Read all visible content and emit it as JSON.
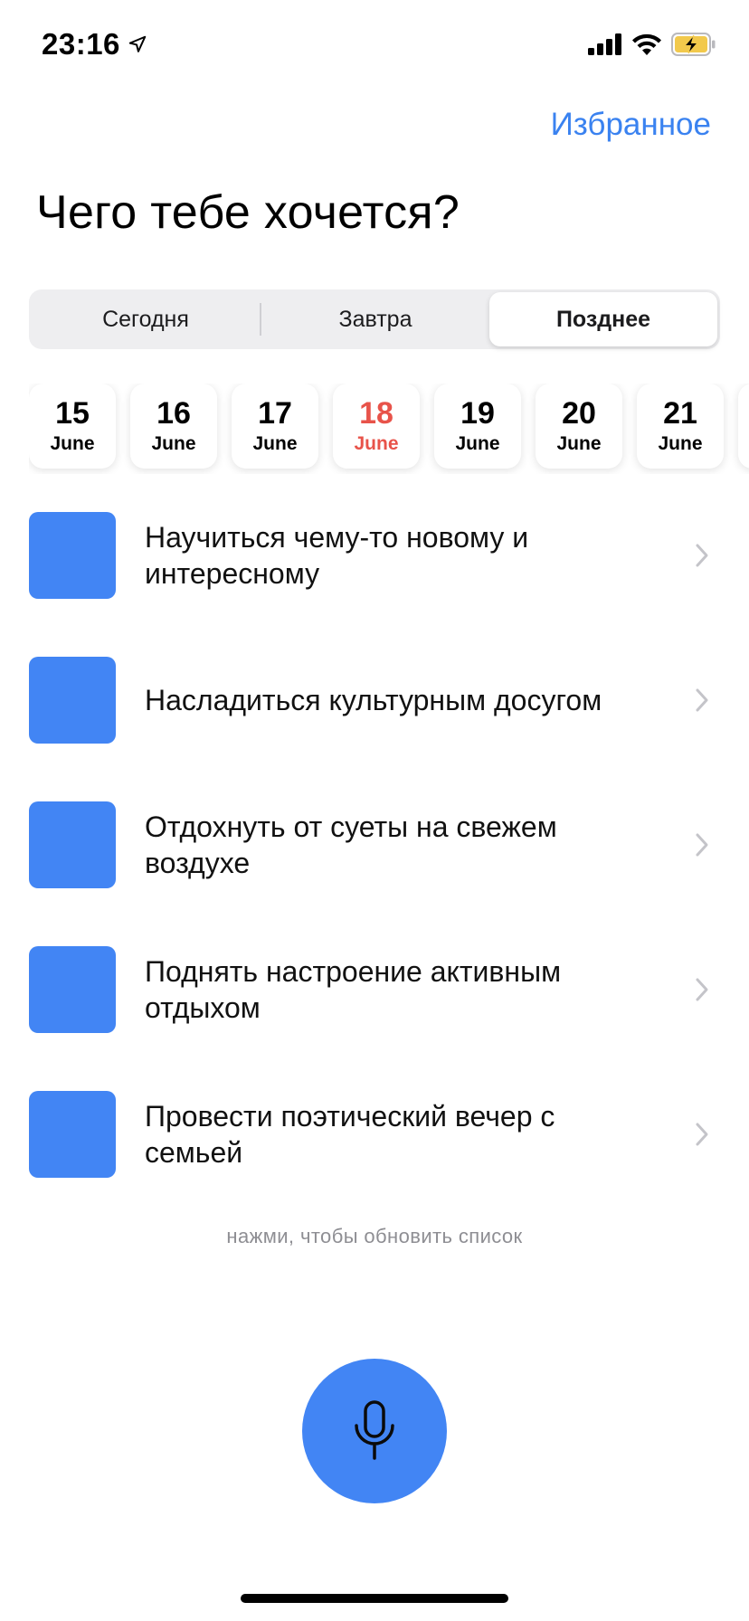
{
  "status_bar": {
    "time": "23:16",
    "icons": [
      "location-arrow-icon",
      "cellular-signal-icon",
      "wifi-icon",
      "battery-charging-icon"
    ],
    "battery_color": "#f2c94c"
  },
  "header": {
    "favorites_label": "Избранное",
    "title": "Чего тебе хочется?"
  },
  "segments": [
    {
      "label": "Сегодня",
      "active": false
    },
    {
      "label": "Завтра",
      "active": false
    },
    {
      "label": "Позднее",
      "active": true
    }
  ],
  "dates": [
    {
      "day": "15",
      "month": "June",
      "selected": false
    },
    {
      "day": "16",
      "month": "June",
      "selected": false
    },
    {
      "day": "17",
      "month": "June",
      "selected": false
    },
    {
      "day": "18",
      "month": "June",
      "selected": true
    },
    {
      "day": "19",
      "month": "June",
      "selected": false
    },
    {
      "day": "20",
      "month": "June",
      "selected": false
    },
    {
      "day": "21",
      "month": "June",
      "selected": false
    }
  ],
  "activities": [
    {
      "label": "Научиться чему-то новому и интересному"
    },
    {
      "label": "Насладиться культурным досугом"
    },
    {
      "label": "Отдохнуть от суеты на свежем воздухе"
    },
    {
      "label": "Поднять настроение активным отдыхом"
    },
    {
      "label": "Провести поэтический вечер с семьей"
    }
  ],
  "refresh_hint": "нажми, чтобы обновить список",
  "mic_button": {
    "icon": "microphone-icon"
  },
  "colors": {
    "accent": "#3a82f0",
    "thumbnail": "#4285f4",
    "selected_date": "#e8534a",
    "mic_button": "#4285f4"
  }
}
